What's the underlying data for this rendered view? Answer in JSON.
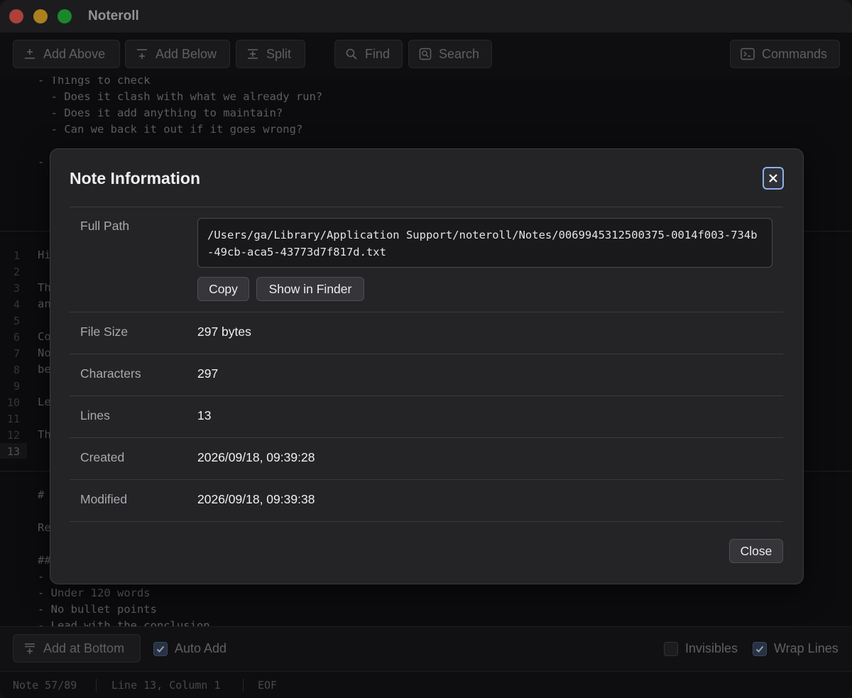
{
  "window": {
    "title": "Noteroll"
  },
  "toolbar": {
    "add_above": "Add Above",
    "add_below": "Add Below",
    "split": "Split",
    "find": "Find",
    "search": "Search",
    "commands": "Commands"
  },
  "pane_top": {
    "lines": [
      "- Things to check",
      "  - Does it clash with what we already run?",
      "  - Does it add anything to maintain?",
      "  - Can we back it out if it goes wrong?",
      "",
      "-"
    ]
  },
  "pane_middle": {
    "line_numbers": [
      "1",
      "2",
      "3",
      "4",
      "5",
      "6",
      "7",
      "8",
      "9",
      "10",
      "11",
      "12",
      "13"
    ],
    "lines": [
      "Hi",
      "",
      "Th",
      "an",
      "",
      "Co",
      "No",
      "be",
      "",
      "Le",
      "",
      "Th",
      ""
    ],
    "active_line": "13"
  },
  "pane_bottom": {
    "lines": [
      "#",
      "",
      "Re",
      "",
      "##",
      "-",
      "- Under 120 words",
      "- No bullet points",
      "- Lead with the conclusion"
    ]
  },
  "bottombar": {
    "add_at_bottom": "Add at Bottom",
    "auto_add": {
      "label": "Auto Add",
      "checked": true
    },
    "invisibles": {
      "label": "Invisibles",
      "checked": false
    },
    "wrap_lines": {
      "label": "Wrap Lines",
      "checked": true
    }
  },
  "statusbar": {
    "note": "Note 57/89",
    "position": "Line 13, Column 1",
    "eof": "EOF"
  },
  "modal": {
    "title": "Note Information",
    "full_path_label": "Full Path",
    "full_path_value": "/Users/ga/Library/Application Support/noteroll/Notes/0069945312500375-0014f003-734b-49cb-aca5-43773d7f817d.txt",
    "copy_button": "Copy",
    "show_in_finder_button": "Show in Finder",
    "rows": [
      {
        "label": "File Size",
        "value": "297 bytes"
      },
      {
        "label": "Characters",
        "value": "297"
      },
      {
        "label": "Lines",
        "value": "13"
      },
      {
        "label": "Created",
        "value": "2026/09/18, 09:39:28"
      },
      {
        "label": "Modified",
        "value": "2026/09/18, 09:39:38"
      }
    ],
    "close_button": "Close"
  }
}
